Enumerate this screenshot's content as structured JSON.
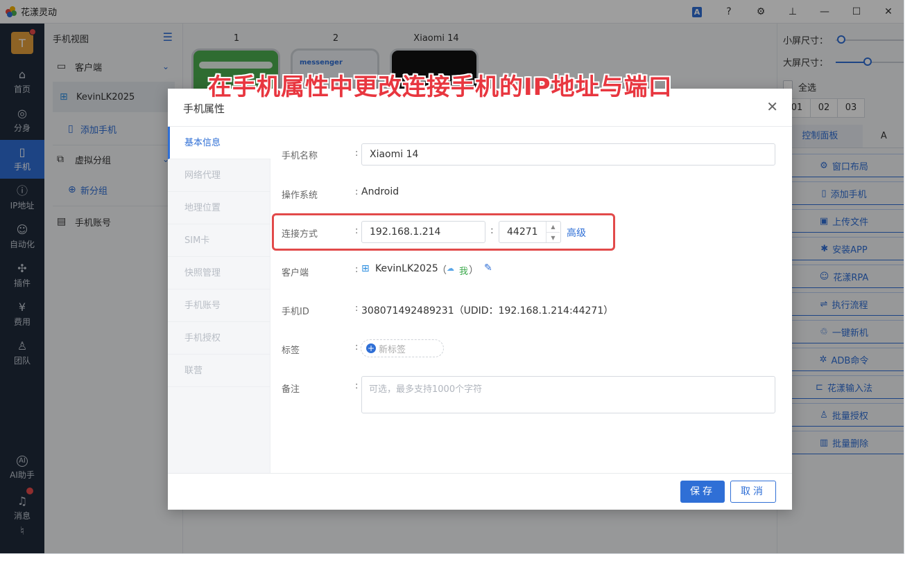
{
  "app": {
    "title": "花漾灵动"
  },
  "titlebar": {
    "translate_icon": "A",
    "help_icon": "?",
    "settings_icon": "⚙",
    "pin_icon": "⊥",
    "minimize": "—",
    "maximize": "☐",
    "close": "✕"
  },
  "leftnav": {
    "avatar_letter": "T",
    "items": [
      {
        "label": "首页",
        "icon": "home-icon"
      },
      {
        "label": "分身",
        "icon": "chrome-icon"
      },
      {
        "label": "手机",
        "icon": "phone-icon"
      },
      {
        "label": "IP地址",
        "icon": "ip-icon"
      },
      {
        "label": "自动化",
        "icon": "robot-icon"
      },
      {
        "label": "插件",
        "icon": "puzzle-icon"
      },
      {
        "label": "费用",
        "icon": "yen-icon"
      },
      {
        "label": "团队",
        "icon": "team-icon"
      }
    ],
    "ai_label": "AI助手",
    "ai_icon_text": "AI",
    "msg_label": "消息"
  },
  "tree": {
    "header": "手机视图",
    "client": "客户端",
    "device": "KevinLK2025",
    "add_phone": "添加手机",
    "virtual_group": "虚拟分组",
    "new_group": "新分组",
    "phone_account": "手机账号"
  },
  "main": {
    "phones": [
      "1",
      "2",
      "Xiaomi 14"
    ],
    "messenger": "messenger"
  },
  "rightpanel": {
    "small_size": "小屏尺寸：",
    "large_size": "大屏尺寸：",
    "select_all": "全选",
    "numbers": [
      "01",
      "02",
      "03"
    ],
    "tab_control": "控制面板",
    "tab_other": "A",
    "buttons": [
      {
        "label": "窗口布局",
        "icon": "⚙"
      },
      {
        "label": "添加手机",
        "icon": "▯"
      },
      {
        "label": "上传文件",
        "icon": "▣"
      },
      {
        "label": "安装APP",
        "icon": "✱"
      },
      {
        "label": "花漾RPA",
        "icon": "☺"
      },
      {
        "label": "执行流程",
        "icon": "⇌"
      },
      {
        "label": "一键新机",
        "icon": "♲"
      },
      {
        "label": "ADB命令",
        "icon": "✲"
      },
      {
        "label": "花漾输入法",
        "icon": "⊏"
      },
      {
        "label": "批量授权",
        "icon": "♙"
      },
      {
        "label": "批量删除",
        "icon": "▥"
      }
    ]
  },
  "caption": "在手机属性中更改连接手机的IP地址与端口",
  "dialog": {
    "title": "手机属性",
    "side_items": [
      "基本信息",
      "网络代理",
      "地理位置",
      "SIM卡",
      "快照管理",
      "手机账号",
      "手机授权",
      "联营"
    ],
    "fields": {
      "name_label": "手机名称",
      "name_value": "Xiaomi 14",
      "os_label": "操作系统",
      "os_value": "Android",
      "conn_label": "连接方式",
      "ip_value": "192.168.1.214",
      "port_value": "44271",
      "advanced": "高级",
      "client_label": "客户端",
      "client_value": "KevinLK2025",
      "client_open": "（",
      "client_me": "我",
      "client_close": "）",
      "id_label": "手机ID",
      "id_value": "308071492489231（UDID：192.168.1.214:44271）",
      "tag_label": "标签",
      "tag_add": "新标签",
      "note_label": "备注",
      "note_placeholder": "可选，最多支持1000个字符"
    },
    "save": "保存",
    "cancel": "取消"
  }
}
